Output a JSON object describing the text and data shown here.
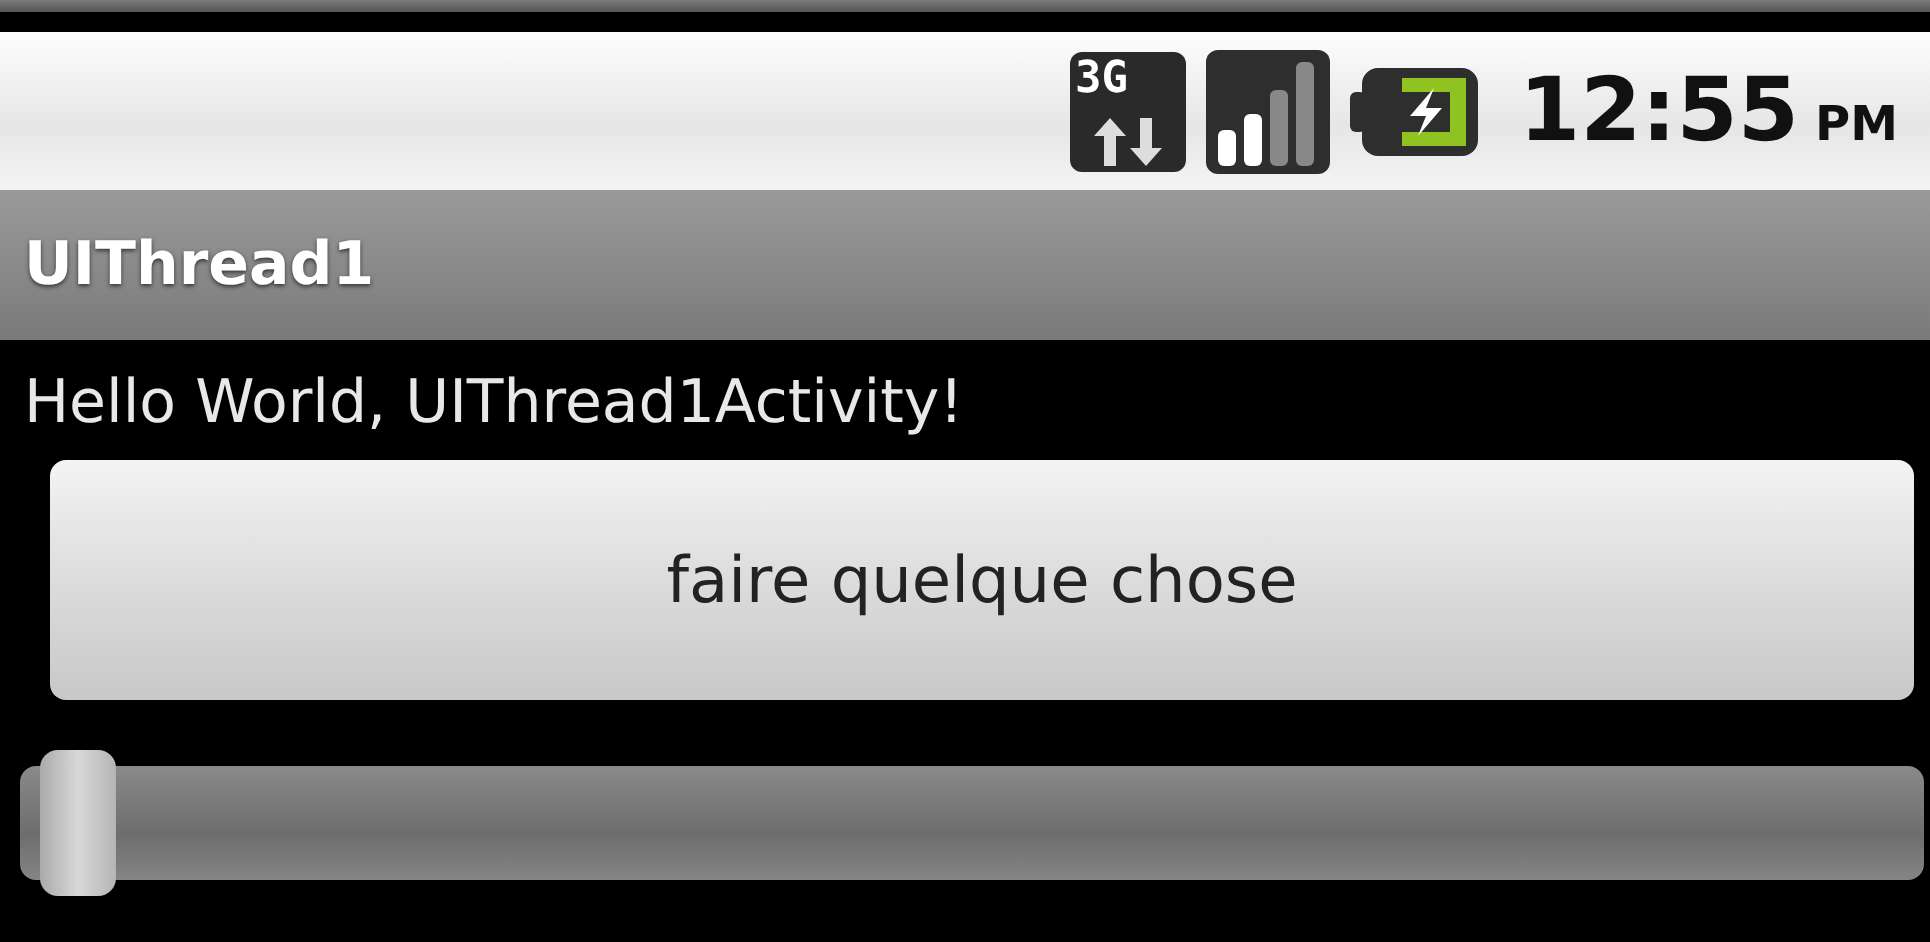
{
  "status_bar": {
    "network_label": "3G",
    "time": "12:55",
    "period": "PM"
  },
  "title_bar": {
    "title": "UIThread1"
  },
  "content": {
    "message": "Hello World, UIThread1Activity!",
    "button": "faire quelque chose",
    "seek_bar": {
      "level": 0
    }
  }
}
